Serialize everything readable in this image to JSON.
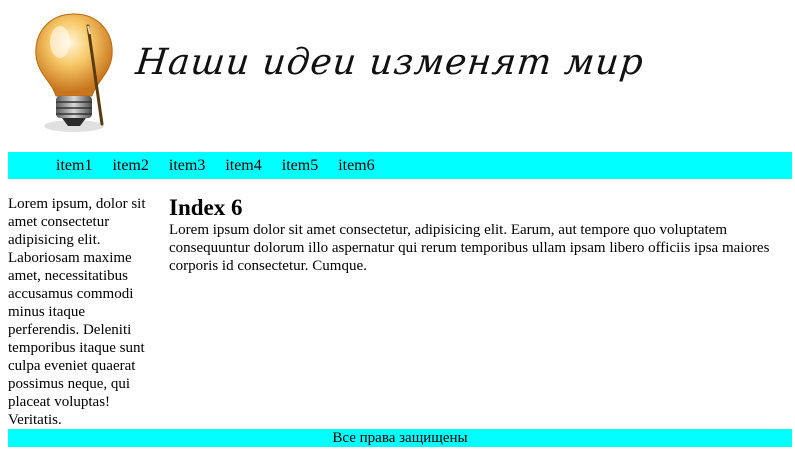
{
  "header": {
    "title": "Наши идеи изменят мир",
    "logo_icon": "lightbulb-icon"
  },
  "nav": {
    "items": [
      {
        "label": "item1"
      },
      {
        "label": "item2"
      },
      {
        "label": "item3"
      },
      {
        "label": "item4"
      },
      {
        "label": "item5"
      },
      {
        "label": "item6"
      }
    ]
  },
  "aside": {
    "text": "Lorem ipsum, dolor sit amet consectetur adipisicing elit. Laboriosam maxime amet, necessitatibus accusamus commodi minus itaque perferendis. Deleniti temporibus itaque sunt culpa eveniet quaerat possimus neque, qui placeat voluptas! Veritatis."
  },
  "main": {
    "heading": "Index 6",
    "paragraph": "Lorem ipsum dolor sit amet consectetur, adipisicing elit. Earum, aut tempore quo voluptatem consequuntur dolorum illo aspernatur qui rerum temporibus ullam ipsam libero officiis ipsa maiores corporis id consectetur. Cumque."
  },
  "footer": {
    "text": "Все права защищены"
  },
  "colors": {
    "nav_background": "#00ffff",
    "footer_background": "#00ffff"
  }
}
